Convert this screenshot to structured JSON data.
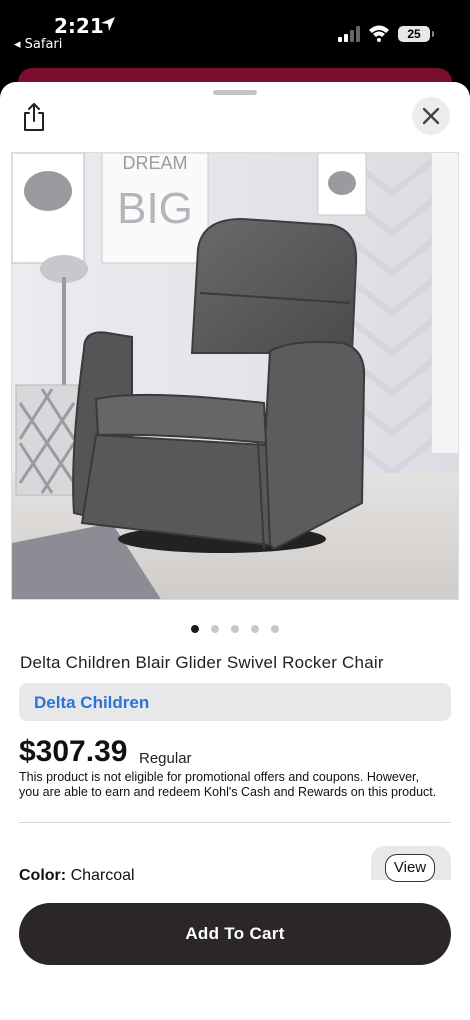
{
  "status_bar": {
    "time": "2:21",
    "back_app": "◂ Safari",
    "battery": "25"
  },
  "sheet": {
    "share_icon": "share-icon",
    "close_icon": "close-icon"
  },
  "carousel": {
    "total": 5,
    "active_index": 0
  },
  "product": {
    "title": "Delta Children Blair Glider Swivel Rocker Chair",
    "brand": "Delta Children",
    "price": "$307.39",
    "price_label": "Regular",
    "promo_note": "This product is not eligible for promotional offers and coupons. However, you are able to earn and redeem Kohl's Cash and Rewards on this product.",
    "color_label": "Color:",
    "color_value": "Charcoal",
    "view_label": "View"
  },
  "cart": {
    "add_to_cart_label": "Add To Cart"
  },
  "colors": {
    "accent_banner": "#7a0e2e",
    "brand_link": "#2a73d9",
    "cart_button": "#2a2726"
  }
}
